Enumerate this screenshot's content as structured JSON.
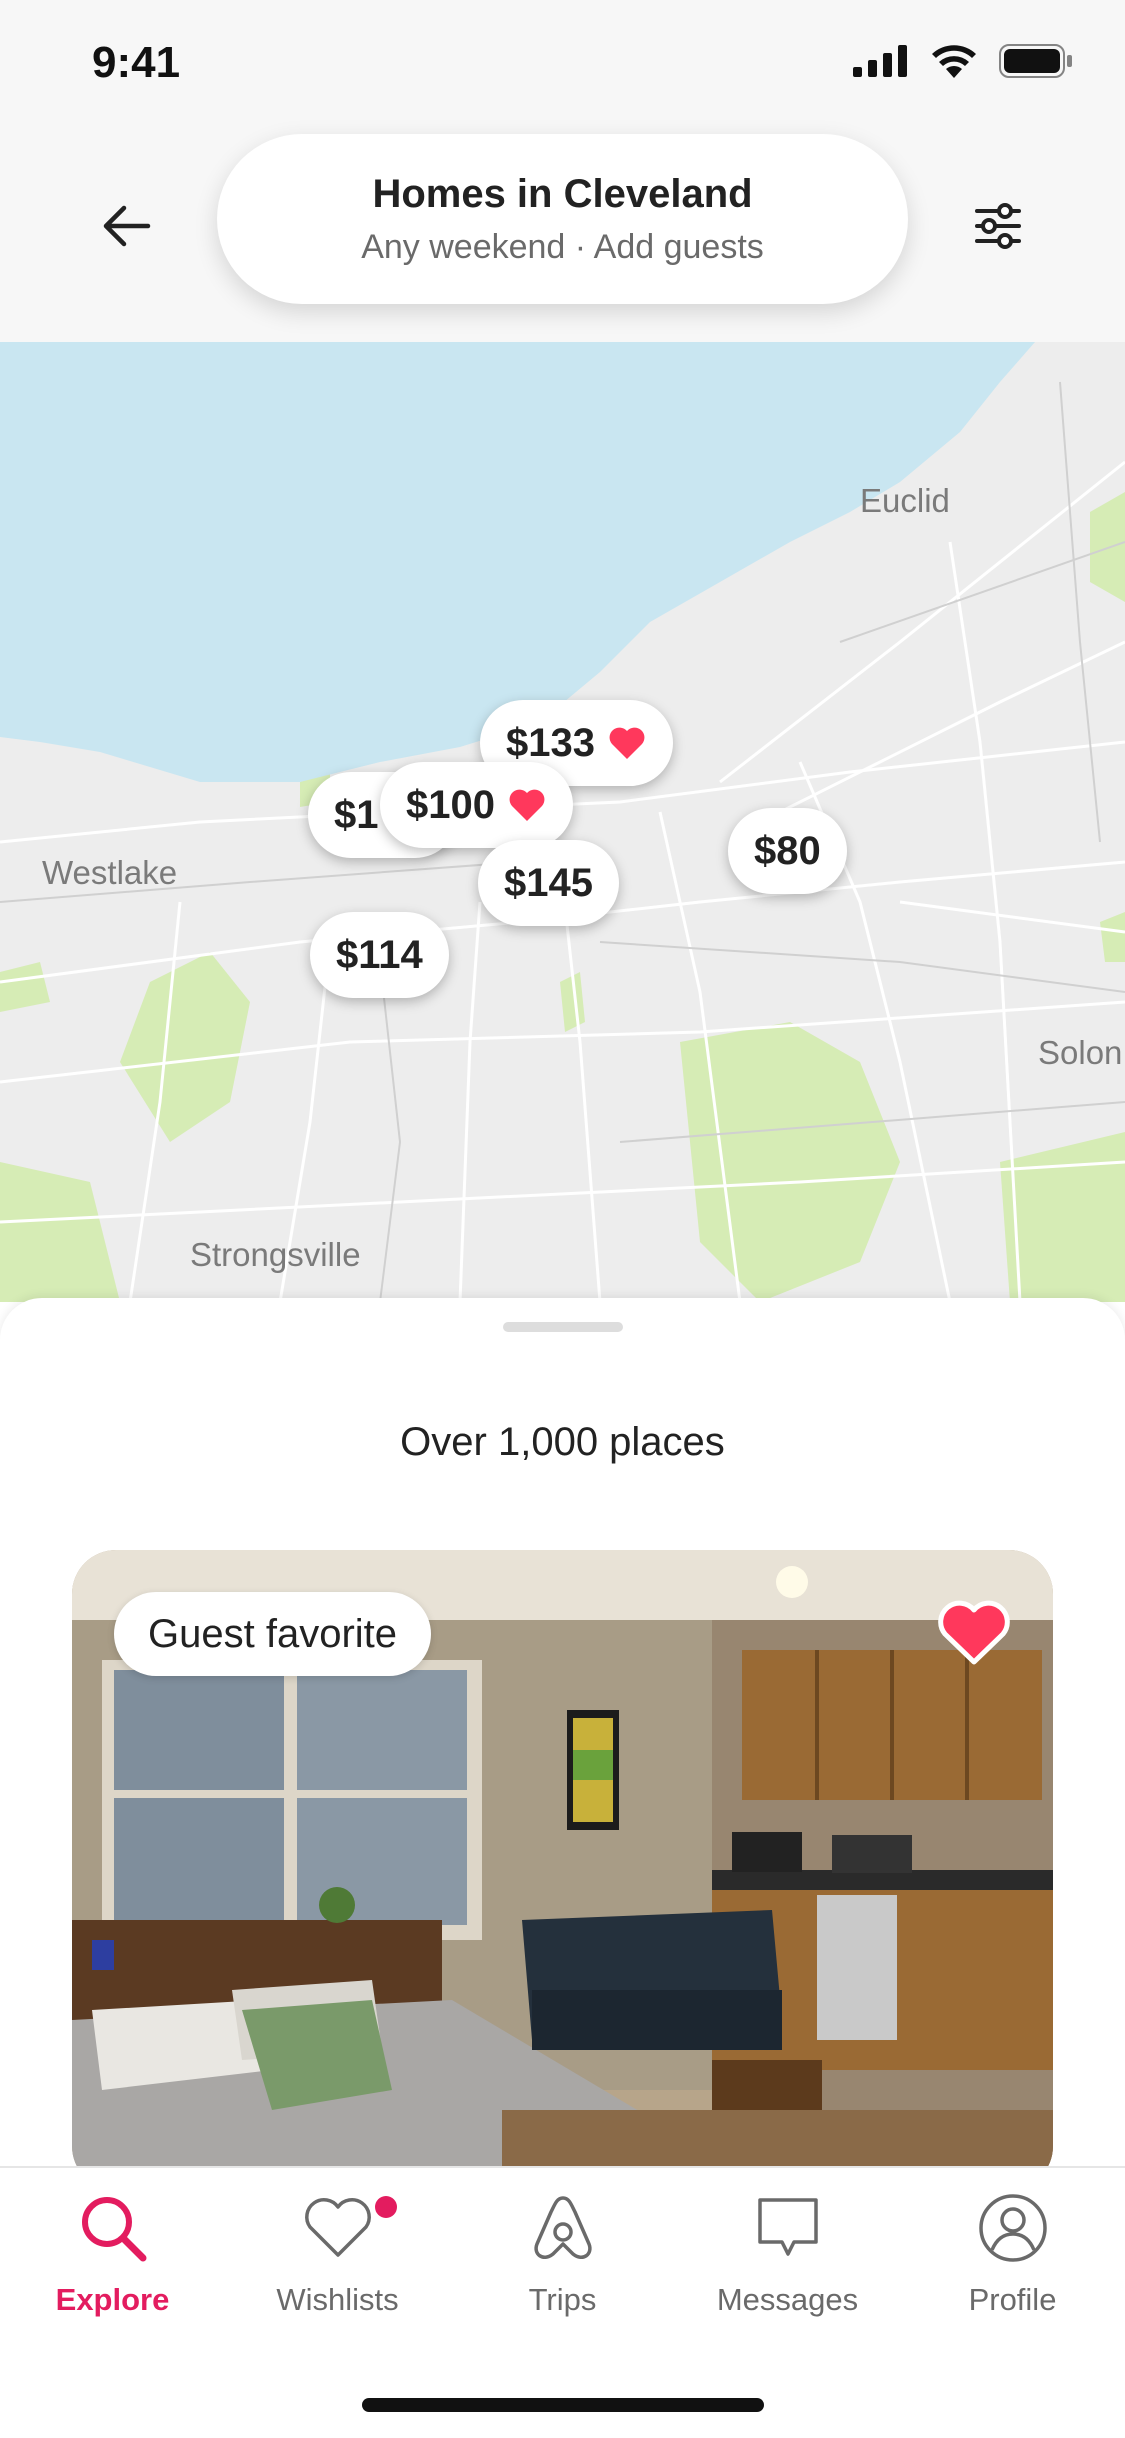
{
  "status": {
    "time": "9:41"
  },
  "search": {
    "title": "Homes in Cleveland",
    "subtitle": "Any weekend · Add guests"
  },
  "map": {
    "places": [
      "Euclid",
      "Westlake",
      "Solon",
      "Strongsville"
    ],
    "pins": [
      {
        "price": "$1",
        "favorite": false
      },
      {
        "price": "$133",
        "favorite": true
      },
      {
        "price": "$100",
        "favorite": true
      },
      {
        "price": "$145",
        "favorite": false
      },
      {
        "price": "$80",
        "favorite": false
      },
      {
        "price": "$114",
        "favorite": false
      }
    ]
  },
  "sheet": {
    "count_label": "Over 1,000 places",
    "listing": {
      "badge": "Guest favorite",
      "wishlisted": true
    }
  },
  "tabs": [
    {
      "label": "Explore",
      "icon": "search-icon",
      "active": true
    },
    {
      "label": "Wishlists",
      "icon": "heart-icon",
      "active": false,
      "dot": true
    },
    {
      "label": "Trips",
      "icon": "airbnb-logo-icon",
      "active": false
    },
    {
      "label": "Messages",
      "icon": "message-icon",
      "active": false
    },
    {
      "label": "Profile",
      "icon": "profile-icon",
      "active": false
    }
  ],
  "colors": {
    "accent": "#e31c5f",
    "heart": "#ff385c",
    "water": "#c9e6f1",
    "land": "#ededed",
    "park": "#d4edb3"
  }
}
